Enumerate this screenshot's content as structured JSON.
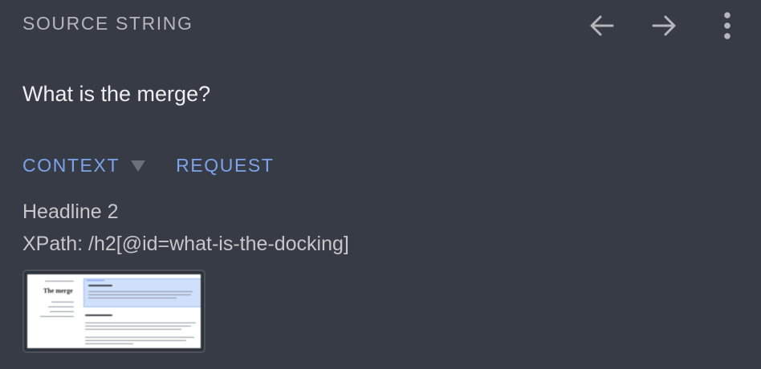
{
  "header": {
    "title": "SOURCE STRING",
    "back_icon": "arrow-left-icon",
    "forward_icon": "arrow-right-icon",
    "more_icon": "more-vertical-icon"
  },
  "source": {
    "text": "What is the merge?"
  },
  "tabs": [
    {
      "label": "CONTEXT",
      "has_dropdown": true
    },
    {
      "label": "REQUEST"
    }
  ],
  "context": {
    "element_type": "Headline 2",
    "xpath": "XPath: /h2[@id=what-is-the-docking]"
  },
  "screenshot": {
    "heading": "The merge"
  },
  "colors": {
    "background": "#373b45",
    "accent": "#7da3ea",
    "primary_text": "#eceef1",
    "secondary_text": "#c4c7cc"
  }
}
